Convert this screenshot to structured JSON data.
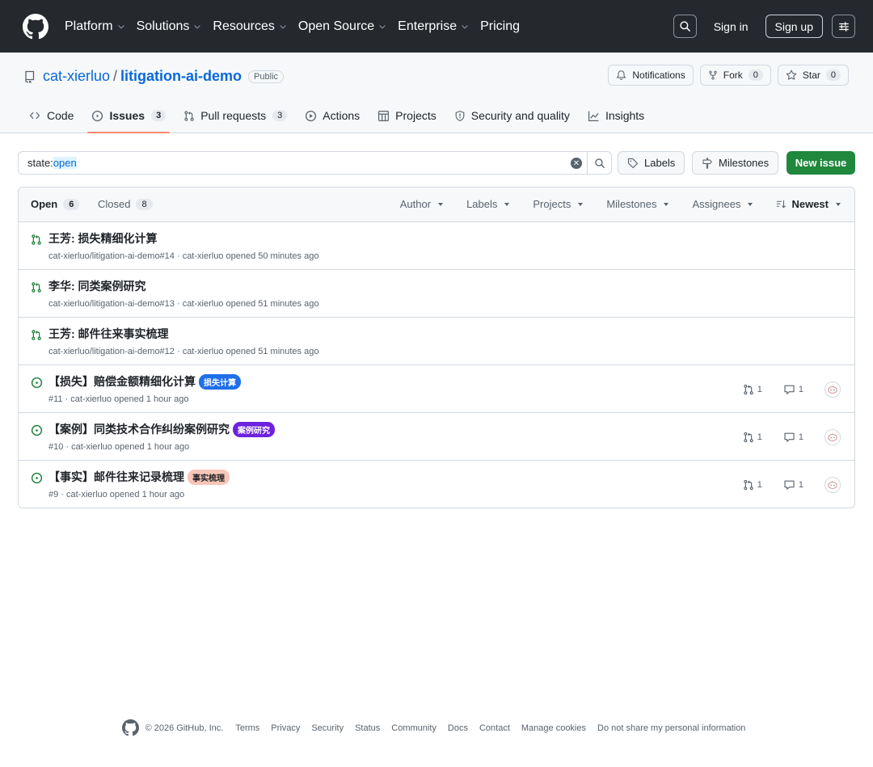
{
  "header": {
    "nav": [
      "Platform",
      "Solutions",
      "Resources",
      "Open Source",
      "Enterprise",
      "Pricing"
    ],
    "sign_in": "Sign in",
    "sign_up": "Sign up"
  },
  "repo": {
    "owner": "cat-xierluo",
    "separator": "/",
    "name": "litigation-ai-demo",
    "visibility": "Public",
    "notifications_label": "Notifications",
    "fork_label": "Fork",
    "fork_count": "0",
    "star_label": "Star",
    "star_count": "0"
  },
  "tabs": [
    {
      "label": "Code",
      "count": ""
    },
    {
      "label": "Issues",
      "count": "3"
    },
    {
      "label": "Pull requests",
      "count": "3"
    },
    {
      "label": "Actions",
      "count": ""
    },
    {
      "label": "Projects",
      "count": ""
    },
    {
      "label": "Security and quality",
      "count": ""
    },
    {
      "label": "Insights",
      "count": ""
    }
  ],
  "filterbar": {
    "query_key": "state:",
    "query_value": "open",
    "labels_button": "Labels",
    "milestones_button": "Milestones",
    "new_issue_button": "New issue"
  },
  "list": {
    "open_label": "Open",
    "open_count": "6",
    "closed_label": "Closed",
    "closed_count": "8",
    "filters": [
      "Author",
      "Labels",
      "Projects",
      "Milestones",
      "Assignees"
    ],
    "sort_label": "Newest"
  },
  "issues": [
    {
      "kind": "pr",
      "title": "王芳: 损失精细化计算",
      "meta": "cat-xierluo/litigation-ai-demo#14 · cat-xierluo opened 50 minutes ago",
      "label": "",
      "prs": "",
      "comments": ""
    },
    {
      "kind": "pr",
      "title": "李华: 同类案例研究",
      "meta": "cat-xierluo/litigation-ai-demo#13 · cat-xierluo opened 51 minutes ago",
      "label": "",
      "prs": "",
      "comments": ""
    },
    {
      "kind": "pr",
      "title": "王芳: 邮件往来事实梳理",
      "meta": "cat-xierluo/litigation-ai-demo#12 · cat-xierluo opened 51 minutes ago",
      "label": "",
      "prs": "",
      "comments": ""
    },
    {
      "kind": "issue",
      "title": "【损失】赔偿金额精细化计算",
      "meta": "#11 · cat-xierluo opened 1 hour ago",
      "label": "损失计算",
      "label_bg": "#1f6feb",
      "label_fg": "#ffffff",
      "prs": "1",
      "comments": "1"
    },
    {
      "kind": "issue",
      "title": "【案例】同类技术合作纠纷案例研究",
      "meta": "#10 · cat-xierluo opened 1 hour ago",
      "label": "案例研究",
      "label_bg": "#6e22e0",
      "label_fg": "#ffffff",
      "prs": "1",
      "comments": "1"
    },
    {
      "kind": "issue",
      "title": "【事实】邮件往来记录梳理",
      "meta": "#9 · cat-xierluo opened 1 hour ago",
      "label": "事实梳理",
      "label_bg": "#f7c5b8",
      "label_fg": "#1f2328",
      "prs": "1",
      "comments": "1"
    }
  ],
  "footer": {
    "copyright": "© 2026 GitHub, Inc.",
    "links": [
      "Terms",
      "Privacy",
      "Security",
      "Status",
      "Community",
      "Docs",
      "Contact",
      "Manage cookies",
      "Do not share my personal information"
    ]
  },
  "colors": {
    "header_bg": "#25292e",
    "link": "#0969da",
    "open_green": "#1a7f37",
    "primary_button": "#1f883d",
    "active_tab_underline": "#fd8c73"
  }
}
